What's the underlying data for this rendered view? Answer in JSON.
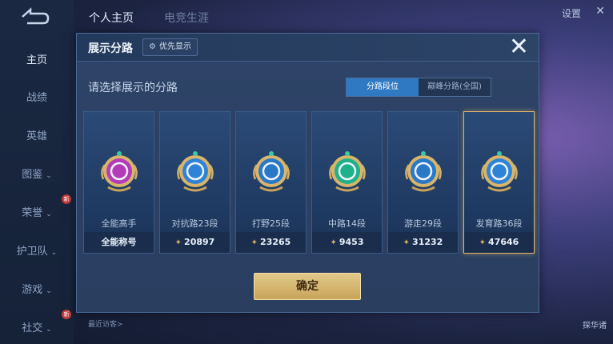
{
  "top": {
    "tabs": [
      "个人主页",
      "电竞生涯"
    ],
    "settings_label": "设置",
    "close_glyph": "✕"
  },
  "sidebar": {
    "items": [
      {
        "label": "主页",
        "chev": ""
      },
      {
        "label": "战绩",
        "chev": ""
      },
      {
        "label": "英雄",
        "chev": ""
      },
      {
        "label": "图鉴",
        "chev": "⌄"
      },
      {
        "label": "荣誉",
        "chev": "⌄"
      },
      {
        "label": "护卫队",
        "chev": "⌄"
      },
      {
        "label": "游戏",
        "chev": "⌄"
      },
      {
        "label": "社交",
        "chev": "⌄"
      }
    ],
    "new_badge": "新"
  },
  "modal": {
    "title": "展示分路",
    "priority_label": "优先显示",
    "close_glyph": "✕",
    "subtitle": "请选择展示的分路",
    "toggle": {
      "left": "分路段位",
      "right": "巅峰分路(全国)"
    },
    "confirm_label": "确定",
    "cards": [
      {
        "name": "全能高手",
        "value": "全能称号",
        "has_bolt": false,
        "color": "#b43bb8"
      },
      {
        "name": "对抗路23段",
        "value": "20897",
        "has_bolt": true,
        "color": "#2f83d6"
      },
      {
        "name": "打野25段",
        "value": "23265",
        "has_bolt": true,
        "color": "#2a78c8"
      },
      {
        "name": "中路14段",
        "value": "9453",
        "has_bolt": true,
        "color": "#1fb28a"
      },
      {
        "name": "游走29段",
        "value": "31232",
        "has_bolt": true,
        "color": "#2a78c8"
      },
      {
        "name": "发育路36段",
        "value": "47646",
        "has_bolt": true,
        "color": "#2f83d6"
      }
    ],
    "selected_index": 5
  },
  "footer": {
    "visitors_label": "最近访客>",
    "right_label": "探华诸"
  }
}
